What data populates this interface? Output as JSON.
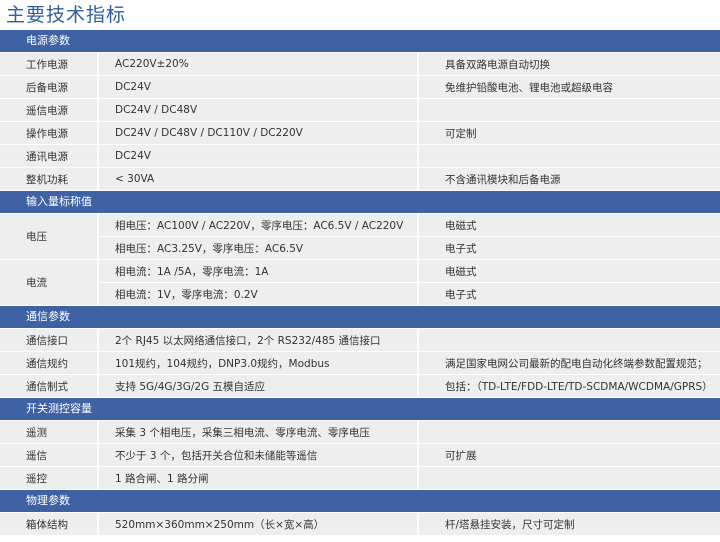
{
  "title": "主要技术指标",
  "sections": [
    {
      "name": "电源参数",
      "rows": [
        {
          "label": "工作电源",
          "value": "AC220V±20%",
          "note": "具备双路电源自动切换"
        },
        {
          "label": "后备电源",
          "value": "DC24V",
          "note": "免维护铅酸电池、锂电池或超级电容"
        },
        {
          "label": "遥信电源",
          "value": "DC24V / DC48V",
          "note": ""
        },
        {
          "label": "操作电源",
          "value": "DC24V / DC48V / DC110V / DC220V",
          "note": "可定制"
        },
        {
          "label": "通讯电源",
          "value": "DC24V",
          "note": ""
        },
        {
          "label": "整机功耗",
          "value": "< 30VA",
          "note": "不含通讯模块和后备电源"
        }
      ]
    },
    {
      "name": "输入量标称值",
      "groups": [
        {
          "label": "电压",
          "subrows": [
            {
              "value": "相电压：AC100V / AC220V，零序电压：AC6.5V / AC220V",
              "note": "电磁式"
            },
            {
              "value": "相电压：AC3.25V，零序电压：AC6.5V",
              "note": "电子式"
            }
          ]
        },
        {
          "label": "电流",
          "subrows": [
            {
              "value": "相电流：1A /5A，零序电流：1A",
              "note": "电磁式"
            },
            {
              "value": "相电流：1V，零序电流：0.2V",
              "note": "电子式"
            }
          ]
        }
      ]
    },
    {
      "name": "通信参数",
      "rows": [
        {
          "label": "通信接口",
          "value": "2个 RJ45 以太网络通信接口，2个 RS232/485 通信接口",
          "note": ""
        },
        {
          "label": "通信规约",
          "value": "101规约，104规约，DNP3.0规约，Modbus",
          "note": "满足国家电网公司最新的配电自动化终端参数配置规范；"
        },
        {
          "label": "通信制式",
          "value": "支持 5G/4G/3G/2G 五模自适应",
          "note": "包括：（TD-LTE/FDD-LTE/TD-SCDMA/WCDMA/GPRS）"
        }
      ]
    },
    {
      "name": "开关测控容量",
      "rows": [
        {
          "label": "遥测",
          "value": "采集 3 个相电压，采集三相电流、零序电流、零序电压",
          "note": ""
        },
        {
          "label": "遥信",
          "value": "不少于 3 个，包括开关合位和未储能等遥信",
          "note": "可扩展"
        },
        {
          "label": "遥控",
          "value": "1 路合闸、1 路分闸",
          "note": ""
        }
      ]
    },
    {
      "name": "物理参数",
      "rows": [
        {
          "label": "箱体结构",
          "value": "520mm×360mm×250mm（长×宽×高）",
          "note": "杆/塔悬挂安装，尺寸可定制"
        }
      ]
    }
  ]
}
